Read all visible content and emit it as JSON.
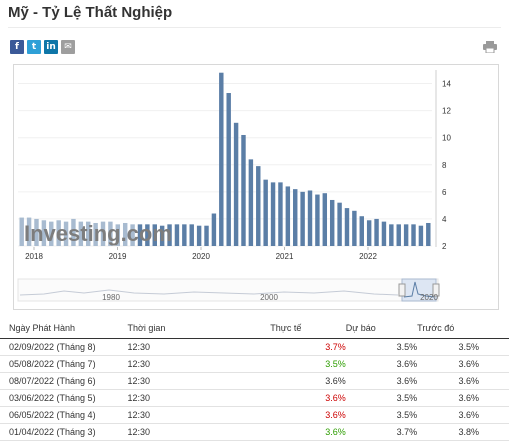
{
  "page": {
    "title": "Mỹ - Tỷ Lệ Thất Nghiệp"
  },
  "share": [
    {
      "icon": "facebook-icon",
      "glyph": "f"
    },
    {
      "icon": "twitter-icon",
      "glyph": "t"
    },
    {
      "icon": "linkedin-icon",
      "glyph": "in"
    },
    {
      "icon": "email-icon",
      "glyph": "✉"
    }
  ],
  "colors": {
    "bar": "#5b7ea6",
    "bar_light": "#a8bbd0",
    "watermark": "#7d7d7d",
    "red": "#cc0000",
    "green": "#2d9d00"
  },
  "chart_data": {
    "type": "bar",
    "watermark": "Investing.com",
    "y_ticks": [
      "14",
      "12",
      "10",
      "8",
      "6",
      "4",
      "2"
    ],
    "ylim": [
      2,
      15
    ],
    "x_ticks": [
      "2018",
      "2019",
      "2020",
      "2021",
      "2022"
    ],
    "values": [
      4.1,
      4.1,
      4.0,
      3.9,
      3.8,
      3.9,
      3.8,
      4.0,
      3.8,
      3.8,
      3.7,
      3.8,
      3.8,
      3.6,
      3.7,
      3.6,
      3.6,
      3.6,
      3.6,
      3.5,
      3.6,
      3.6,
      3.6,
      3.6,
      3.5,
      3.5,
      4.4,
      14.8,
      13.3,
      11.1,
      10.2,
      8.4,
      7.9,
      6.9,
      6.7,
      6.7,
      6.4,
      6.2,
      6.0,
      6.1,
      5.8,
      5.9,
      5.4,
      5.2,
      4.8,
      4.6,
      4.2,
      3.9,
      4.0,
      3.8,
      3.6,
      3.6,
      3.6,
      3.6,
      3.5,
      3.7
    ],
    "navigator": {
      "labels": [
        "1980",
        "2000",
        "2020"
      ]
    }
  },
  "table": {
    "headers": {
      "date": "Ngày Phát Hành",
      "time": "Thời gian",
      "actual": "Thực tế",
      "forecast": "Dự báo",
      "previous": "Trước đó"
    },
    "rows": [
      {
        "date": "02/09/2022 (Tháng 8)",
        "time": "12:30",
        "actual": "3.7%",
        "status": "red",
        "forecast": "3.5%",
        "previous": "3.5%"
      },
      {
        "date": "05/08/2022 (Tháng 7)",
        "time": "12:30",
        "actual": "3.5%",
        "status": "green",
        "forecast": "3.6%",
        "previous": "3.6%"
      },
      {
        "date": "08/07/2022 (Tháng 6)",
        "time": "12:30",
        "actual": "3.6%",
        "status": "black",
        "forecast": "3.6%",
        "previous": "3.6%"
      },
      {
        "date": "03/06/2022 (Tháng 5)",
        "time": "12:30",
        "actual": "3.6%",
        "status": "red",
        "forecast": "3.5%",
        "previous": "3.6%"
      },
      {
        "date": "06/05/2022 (Tháng 4)",
        "time": "12:30",
        "actual": "3.6%",
        "status": "red",
        "forecast": "3.5%",
        "previous": "3.6%"
      },
      {
        "date": "01/04/2022 (Tháng 3)",
        "time": "12:30",
        "actual": "3.6%",
        "status": "green",
        "forecast": "3.7%",
        "previous": "3.8%"
      }
    ]
  }
}
